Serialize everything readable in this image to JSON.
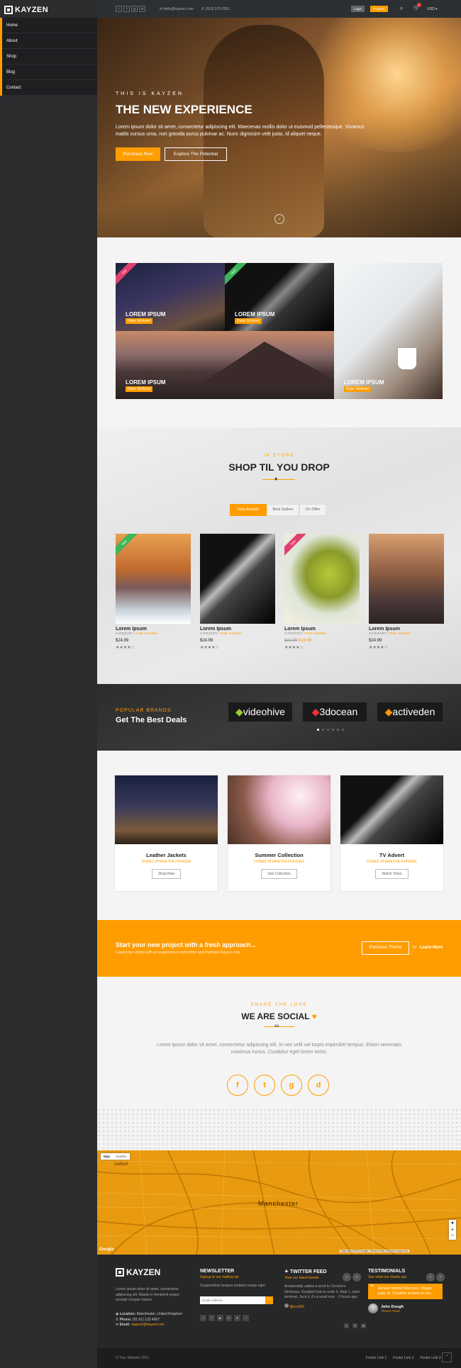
{
  "brand": {
    "name": "KAYZEN",
    "accent": "#ff9d00"
  },
  "sidebar": {
    "items": [
      {
        "label": "Home"
      },
      {
        "label": "About"
      },
      {
        "label": "Shop"
      },
      {
        "label": "Blog"
      },
      {
        "label": "Contact"
      }
    ]
  },
  "topbar": {
    "social": [
      {
        "icon": "twitter-icon",
        "glyph": "t"
      },
      {
        "icon": "facebook-icon",
        "glyph": "f"
      },
      {
        "icon": "google-plus-icon",
        "glyph": "g"
      },
      {
        "icon": "linkedin-icon",
        "glyph": "in"
      }
    ],
    "email": "hello@kayzen.com",
    "phone": "(310) 376-2351",
    "login": "Login",
    "register": "Register",
    "cart_count": "1",
    "currency": "USD"
  },
  "hero": {
    "kicker": "THIS IS KAYZEN",
    "title": "THE NEW EXPERIENCE",
    "text": "Lorem ipsum dolor sit amet, consectetur adipiscing elit. Maecenas mollis dolor ut euismod pellentesque. Vivamus mattis cursus urna, non gravida purus pulvinar ac. Nunc dignissim velit justo, id aliquet neque.",
    "primary_button": "Purchase Now",
    "secondary_button": "Explore The Potential"
  },
  "featured_tiles": [
    {
      "title": "LOREM IPSUM",
      "subtitle": "Dolor Sit Amet",
      "ribbon": "Hot"
    },
    {
      "title": "LOREM IPSUM",
      "subtitle": "Dolor Sit Amet",
      "ribbon": "New"
    },
    {
      "title": "LOREM IPSUM",
      "subtitle": "Dolor Sit Amet",
      "ribbon": ""
    },
    {
      "title": "LOREM IPSUM",
      "subtitle": "Dolor Sit Amet",
      "ribbon": ""
    }
  ],
  "shop": {
    "kicker": "IN STORE",
    "title": "SHOP TIL YOU DROP",
    "tabs": [
      {
        "label": "New Arrivals"
      },
      {
        "label": "Best Sellers"
      },
      {
        "label": "On Offer"
      }
    ],
    "products": [
      {
        "name": "Lorem Ipsum",
        "category_label": "CATEGORY:",
        "category": "HTML THEMES",
        "price": "$24.99",
        "old_price": "",
        "ribbon": "New"
      },
      {
        "name": "Lorem Ipsum",
        "category_label": "CATEGORY:",
        "category": "HTML THEMES",
        "price": "$24.99",
        "old_price": "",
        "ribbon": ""
      },
      {
        "name": "Lorem Ipsum",
        "category_label": "CATEGORY:",
        "category": "HTML THEMES",
        "price": "$19.99",
        "old_price": "$24.99",
        "ribbon": "Sale"
      },
      {
        "name": "Lorem Ipsum",
        "category_label": "CATEGORY:",
        "category": "HTML THEMES",
        "price": "$24.99",
        "old_price": "",
        "ribbon": ""
      }
    ],
    "rating": 4,
    "rating_max": 5
  },
  "brands": {
    "kicker": "POPULAR BRANDS",
    "title": "Get The Best Deals",
    "logos": [
      {
        "name": "videohive"
      },
      {
        "name": "3docean"
      },
      {
        "name": "activeden"
      }
    ]
  },
  "features": [
    {
      "title": "Leather Jackets",
      "subtitle": "DONEC PHARETRA FRINGER",
      "button": "Shop Now"
    },
    {
      "title": "Summer Collection",
      "subtitle": "DONEC PHARETRA FRINGER",
      "button": "See Collection"
    },
    {
      "title": "TV Advert",
      "subtitle": "DONEC PHARETRA FRINGER",
      "button": "Watch Video"
    }
  ],
  "cta": {
    "title_start": "Start your new project with a ",
    "title_em": "fresh",
    "title_end": " approach...",
    "subtitle": "Leave your visitors with an experience to remember and Purchase Kayzen now.",
    "button": "Purchase Theme",
    "or": "or",
    "link": "Learn More"
  },
  "social": {
    "kicker": "SHARE THE LOVE",
    "title": "WE ARE SOCIAL",
    "text": "Lorem ipsum dolor sit amet, consectetur adipiscing elit. In nec velit vel turpis imperdiet tempus. Etiam venenatis maximus luctus. Curabitur eget lorem tortor.",
    "icons": [
      {
        "name": "facebook-icon",
        "glyph": "f"
      },
      {
        "name": "twitter-icon",
        "glyph": "t"
      },
      {
        "name": "github-icon",
        "glyph": "g"
      },
      {
        "name": "dribbble-icon",
        "glyph": "d"
      }
    ]
  },
  "map": {
    "tabs": [
      {
        "label": "Map"
      },
      {
        "label": "Satellite"
      }
    ],
    "city": "Manchester",
    "place": "Salford",
    "provider": "Google",
    "copyright": "Map data ©2015 Google",
    "terms": "Terms of Use",
    "report": "Report a map error"
  },
  "footer": {
    "about": "Lorem ipsum dolor sit amet, consectetur adipiscing elit. Mauris in hendrerit neque, suscipit congue mauris.",
    "location_label": "Location:",
    "location": "Manchester, United Kingdom",
    "phone_label": "Phone:",
    "phone": "(01 61) 123 4567",
    "email_label": "Email:",
    "email": "support@kayzen.net",
    "newsletter_title": "NEWSLETTER",
    "newsletter_sub": "Signup to our mailing list",
    "newsletter_text": "Suspendisse tempus sodales neque eget.",
    "newsletter_placeholder": "Email Address",
    "twitter_title": "TWITTER FEED",
    "twitter_sub": "View our latest tweets",
    "tweet": "Accidentally added a word to Chrome's dictionary. Googled how to undo it. Step 1, open terminal...fuck it, it's a word now. - 2 hours ago",
    "tweet_user": "@esr360",
    "testimonials_title": "TESTIMONIALS",
    "testimonials_sub": "See what our clients say",
    "quote": "Aenean lobortis felis nunc. Integer justo mi. Curabitur at enim ex nec.",
    "quote_name": "John Dough",
    "quote_role": "Theme Fiend",
    "copyright": "© Your Website 2015",
    "links": [
      {
        "label": "Footer Link 1"
      },
      {
        "label": "Footer Link 2"
      },
      {
        "label": "Footer Link 3"
      }
    ]
  }
}
